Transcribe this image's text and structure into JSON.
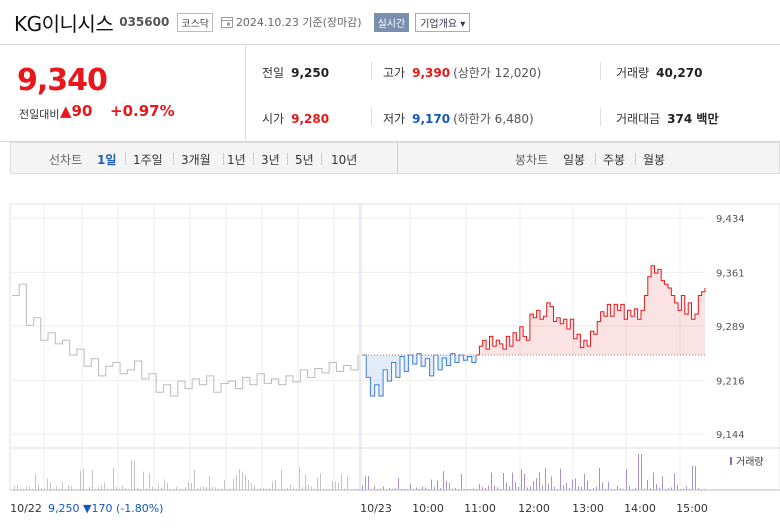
{
  "header": {
    "stock_name": "KG이니시스",
    "stock_code": "035600",
    "market": "코스닥",
    "date": "2024.10.23 기준(장마감)",
    "realtime_button": "실시간",
    "company_info_button": "기업개요 ▾"
  },
  "summary": {
    "current_price": "9,340",
    "change_label": "전일대비",
    "change_value": "▲90",
    "change_pct": "+0.97%",
    "prev_close": {
      "label": "전일",
      "value": "9,250"
    },
    "open": {
      "label": "시가",
      "value": "9,280"
    },
    "high": {
      "label": "고가",
      "value": "9,390",
      "limit": "(상한가 12,020)"
    },
    "low": {
      "label": "저가",
      "value": "9,170",
      "limit": "(하한가 6,480)"
    },
    "volume": {
      "label": "거래량",
      "value": "40,270"
    },
    "trade_amount": {
      "label": "거래대금",
      "value": "374 백만"
    }
  },
  "period_bar": {
    "line_label": "선차트",
    "line_items": [
      "1일",
      "1주일",
      "3개월",
      "1년",
      "3년",
      "5년",
      "10년"
    ],
    "active_item": "1일",
    "candle_label": "봉차트",
    "candle_items": [
      "일봉",
      "주봉",
      "월봉"
    ]
  },
  "chart_data": {
    "type": "line",
    "y_ticks": [
      "9,434",
      "9,361",
      "9,289",
      "9,216",
      "9,144"
    ],
    "y_tick_values": [
      9434,
      9361,
      9289,
      9216,
      9144
    ],
    "ylim": [
      9144,
      9434
    ],
    "x_tick_labels": [
      "10/22",
      "10/23",
      "10:00",
      "11:00",
      "12:00",
      "13:00",
      "14:00",
      "15:00"
    ],
    "reference_price": 9250,
    "volume_label": "거래량",
    "prev_day_summary": {
      "date": "10/22",
      "price": "9,250",
      "change": "▼170",
      "pct": "(-1.80%)"
    },
    "series": [
      {
        "values": [
          9330,
          9345,
          9290,
          9300,
          9270,
          9280,
          9265,
          9270,
          9250,
          9258,
          9235,
          9245,
          9222,
          9235,
          9240,
          9225,
          9230,
          9242,
          9218,
          9225,
          9200,
          9210,
          9195,
          9215,
          9205,
          9218,
          9210,
          9222,
          9200,
          9212,
          9215,
          9205,
          9220,
          9210,
          9225,
          9212,
          9218,
          9210,
          9222,
          9214,
          9230,
          9220,
          9232,
          9226,
          9240,
          9228,
          9236,
          9230,
          9250
        ],
        "color": "#bbbbbb"
      },
      {
        "values": [
          9250,
          9220,
          9195,
          9210,
          9195,
          9230,
          9215,
          9240,
          9220,
          9248,
          9228,
          9250,
          9238,
          9252,
          9235,
          9245,
          9222,
          9250,
          9230,
          9246,
          9236,
          9252,
          9240,
          9250,
          9243,
          9248,
          9240,
          9250
        ],
        "color": "#3d7fd8"
      },
      {
        "values": [
          9250,
          9262,
          9270,
          9258,
          9275,
          9262,
          9270,
          9265,
          9258,
          9275,
          9262,
          9280,
          9270,
          9288,
          9275,
          9270,
          9305,
          9300,
          9310,
          9298,
          9302,
          9320,
          9315,
          9295,
          9300,
          9292,
          9298,
          9285,
          9298,
          9272,
          9278,
          9260,
          9270,
          9262,
          9282,
          9278,
          9295,
          9308,
          9302,
          9318,
          9302,
          9318,
          9310,
          9318,
          9298,
          9310,
          9302,
          9312,
          9298,
          9310,
          9330,
          9355,
          9370,
          9360,
          9365,
          9350,
          9345,
          9340,
          9330,
          9320,
          9310,
          9330,
          9305,
          9320,
          9298,
          9305,
          9330,
          9335,
          9340
        ],
        "color": "#e8171c"
      }
    ]
  }
}
